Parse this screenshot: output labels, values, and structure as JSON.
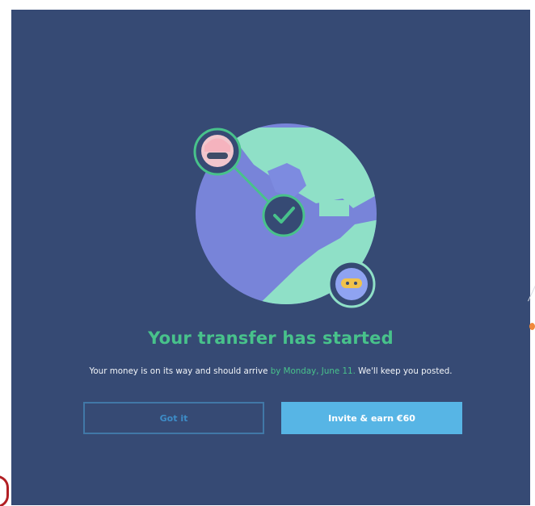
{
  "dialog": {
    "title": "Your transfer has started",
    "message_prefix": "Your money is on its way and should arrive ",
    "message_highlight": "by Monday, June 11.",
    "message_suffix": " We'll keep you posted.",
    "buttons": {
      "got_it": "Got it",
      "invite": "Invite & earn €60"
    }
  },
  "colors": {
    "background": "#364a74",
    "accent_green": "#48c28b",
    "primary_button": "#57b5e5",
    "secondary_button_border": "#4178a7"
  },
  "icons": {
    "sender_avatar": "sender-avatar-icon",
    "recipient_avatar": "recipient-avatar-icon",
    "success_check": "check-circle-icon",
    "globe": "globe-illustration"
  }
}
